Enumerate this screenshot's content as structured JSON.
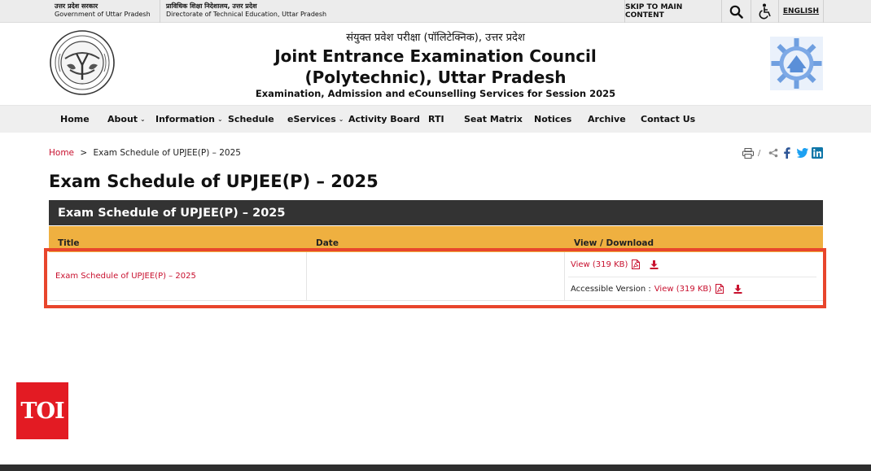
{
  "topbar": {
    "gov_up_hindi": "उत्तर प्रदेश सरकार",
    "gov_up_english": "Government of Uttar Pradesh",
    "dte_hindi": "प्राविधिक शिक्षा निदेशालय, उत्तर प्रदेश",
    "dte_english": "Directorate of Technical Education, Uttar Pradesh",
    "skip_label": "SKIP TO MAIN CONTENT",
    "search_icon": "search-icon",
    "accessibility_icon": "wheelchair-icon",
    "language_label": "ENGLISH"
  },
  "header": {
    "hindi_title": "संयुक्त प्रवेश परीक्षा (पॉलिटेक्निक), उत्तर प्रदेश",
    "title_line1": "Joint Entrance Examination Council",
    "title_line2": "(Polytechnic), Uttar Pradesh",
    "subtitle": "Examination, Admission and eCounselling Services for Session 2025",
    "left_logo": "up-government-emblem",
    "right_logo": "jeec-logo"
  },
  "nav": {
    "items": [
      {
        "label": "Home",
        "dropdown": false
      },
      {
        "label": "About",
        "dropdown": true
      },
      {
        "label": "Information",
        "dropdown": true
      },
      {
        "label": "Schedule",
        "dropdown": false
      },
      {
        "label": "eServices",
        "dropdown": true
      },
      {
        "label": "Activity Board",
        "dropdown": false
      },
      {
        "label": "RTI",
        "dropdown": false
      },
      {
        "label": "Seat Matrix",
        "dropdown": false
      },
      {
        "label": "Notices",
        "dropdown": false
      },
      {
        "label": "Archive",
        "dropdown": false
      },
      {
        "label": "Contact Us",
        "dropdown": false
      }
    ]
  },
  "breadcrumb": {
    "home": "Home",
    "separator": ">",
    "current": "Exam Schedule of UPJEE(P) – 2025"
  },
  "share": {
    "separator": "/",
    "icons": [
      "print-icon",
      "share-icon",
      "facebook-icon",
      "twitter-icon",
      "linkedin-icon"
    ]
  },
  "page": {
    "title": "Exam Schedule of UPJEE(P) – 2025"
  },
  "table": {
    "caption": "Exam Schedule of UPJEE(P) – 2025",
    "columns": [
      "Title",
      "Date",
      "View / Download"
    ],
    "rows": [
      {
        "title": "Exam Schedule of UPJEE(P) – 2025",
        "date": "",
        "view_label": "View (319 KB)",
        "accessible_prefix": "Accessible Version :",
        "accessible_view_label": "View (319 KB)"
      }
    ]
  },
  "colors": {
    "accent_red": "#c8102e",
    "table_header": "#333333",
    "column_header": "#efb040",
    "highlight_box": "#e8452c",
    "toi_red": "#e31b23"
  },
  "watermark": {
    "label": "TOI"
  }
}
